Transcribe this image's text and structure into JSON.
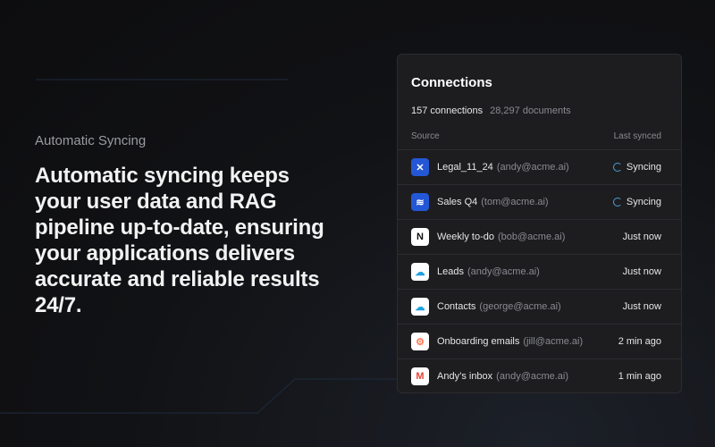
{
  "eyebrow": "Automatic Syncing",
  "headline": "Automatic syncing keeps your user data and RAG pipeline up-to-date, ensuring your applications delivers accurate and reliable results 24/7.",
  "card": {
    "title": "Connections",
    "connections": "157 connections",
    "documents": "28,297 documents",
    "col_source": "Source",
    "col_synced": "Last synced",
    "rows": [
      {
        "name": "Legal_11_24",
        "account": "(andy@acme.ai)",
        "status": "Syncing",
        "icon": "confluence-icon"
      },
      {
        "name": "Sales Q4",
        "account": "(tom@acme.ai)",
        "status": "Syncing",
        "icon": "jira-icon"
      },
      {
        "name": "Weekly to-do",
        "account": "(bob@acme.ai)",
        "status": "Just now",
        "icon": "notion-icon"
      },
      {
        "name": "Leads",
        "account": "(andy@acme.ai)",
        "status": "Just now",
        "icon": "salesforce-icon"
      },
      {
        "name": "Contacts",
        "account": "(george@acme.ai)",
        "status": "Just now",
        "icon": "salesforce-icon"
      },
      {
        "name": "Onboarding emails",
        "account": "(jill@acme.ai)",
        "status": "2 min ago",
        "icon": "hubspot-icon"
      },
      {
        "name": "Andy’s inbox",
        "account": "(andy@acme.ai)",
        "status": "1 min ago",
        "icon": "gmail-icon"
      }
    ]
  }
}
